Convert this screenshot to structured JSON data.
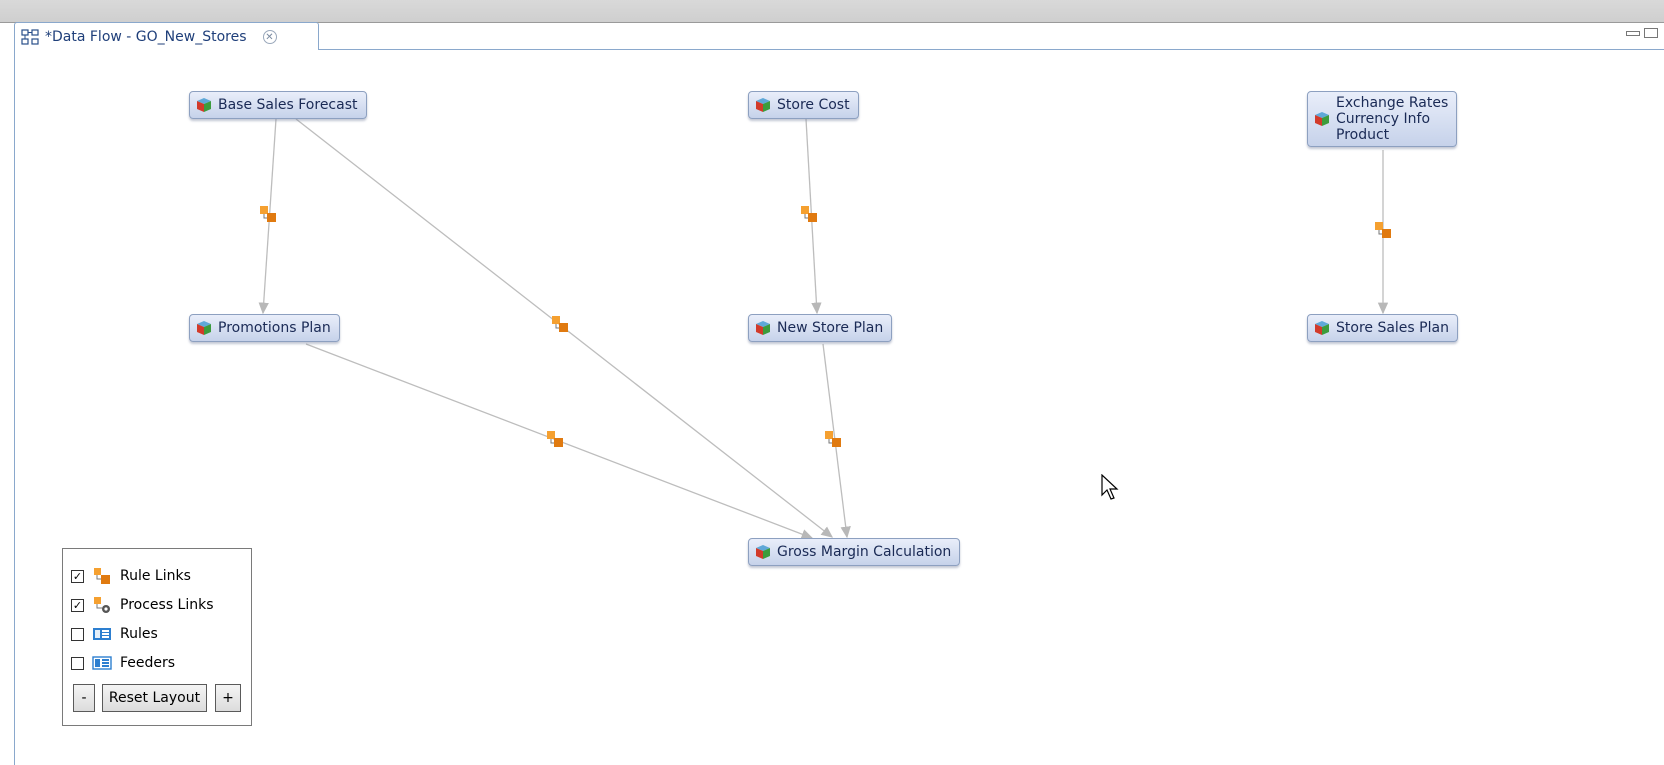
{
  "editor": {
    "tab_title": "*Data Flow - GO_New_Stores",
    "tab_icon": "data-flow-icon"
  },
  "nodes": {
    "base_sales_forecast": "Base Sales Forecast",
    "store_cost": "Store Cost",
    "exchange_rates": "Exchange Rates\nCurrency Info\nProduct",
    "promotions_plan": "Promotions Plan",
    "new_store_plan": "New Store Plan",
    "store_sales_plan": "Store Sales Plan",
    "gross_margin_calculation": "Gross Margin Calculation"
  },
  "node_icon": "cube-icon",
  "links": [
    {
      "from": "Base Sales Forecast",
      "to": "Promotions Plan",
      "type": "rule-link"
    },
    {
      "from": "Base Sales Forecast",
      "to": "Gross Margin Calculation",
      "type": "rule-link"
    },
    {
      "from": "Store Cost",
      "to": "New Store Plan",
      "type": "rule-link"
    },
    {
      "from": "Exchange Rates Currency Info Product",
      "to": "Store Sales Plan",
      "type": "rule-link"
    },
    {
      "from": "Promotions Plan",
      "to": "Gross Margin Calculation",
      "type": "rule-link"
    },
    {
      "from": "New Store Plan",
      "to": "Gross Margin Calculation",
      "type": "rule-link"
    }
  ],
  "legend": {
    "items": [
      {
        "label": "Rule Links",
        "checked": true,
        "icon": "rule-link-icon"
      },
      {
        "label": "Process Links",
        "checked": true,
        "icon": "process-link-icon"
      },
      {
        "label": "Rules",
        "checked": false,
        "icon": "rules-icon"
      },
      {
        "label": "Feeders",
        "checked": false,
        "icon": "feeders-icon"
      }
    ],
    "minus_label": "-",
    "reset_label": "Reset Layout",
    "plus_label": "+"
  },
  "colors": {
    "node_border": "#8da0c0",
    "link_line": "#bbbbbb",
    "rule_link_orange": "#e8891c",
    "tab_border": "#8aa8cc"
  }
}
